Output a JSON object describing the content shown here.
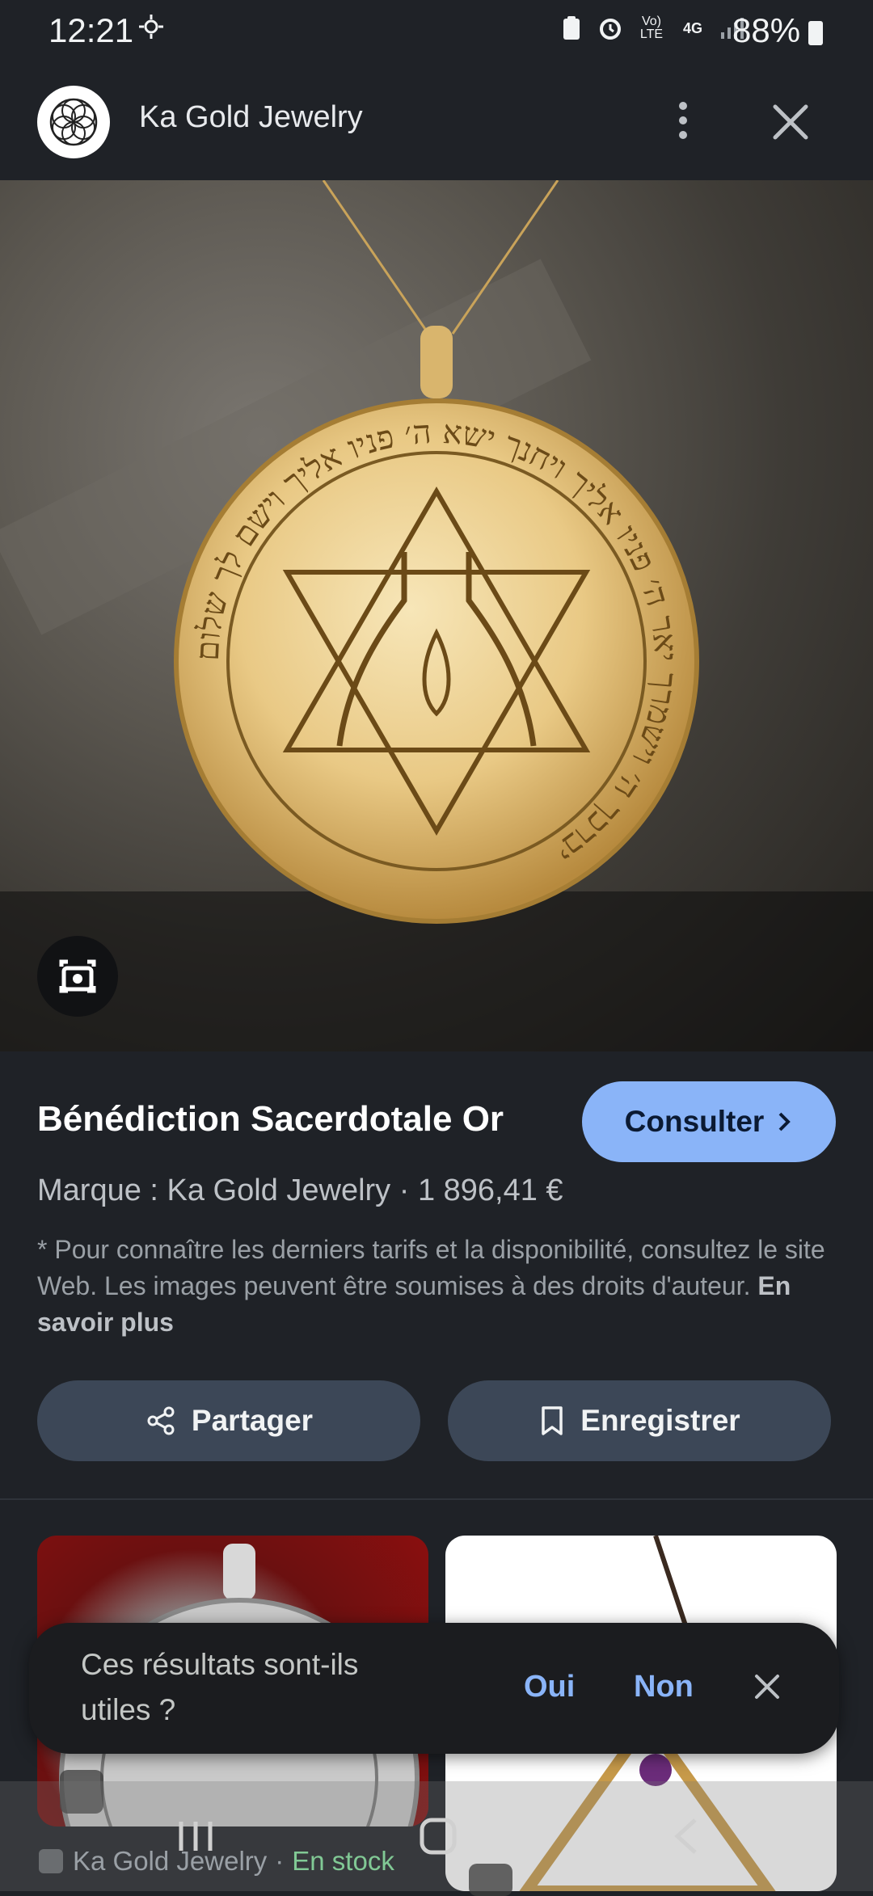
{
  "status_bar": {
    "time": "12:21",
    "battery": "88%",
    "network": "4G",
    "volte": "Vo) LTE"
  },
  "header": {
    "site_name": "Ka Gold Jewelry",
    "menu_icon": "more-vert-icon",
    "close_icon": "close-icon"
  },
  "product": {
    "title": "Bénédiction Sacerdotale Or",
    "visit_label": "Consulter",
    "brand_line": "Marque : Ka Gold Jewelry · 1 896,41 €",
    "disclaimer": "* Pour connaître les derniers tarifs et la disponibilité, consultez le site Web. Les images peuvent être soumises à des droits d'auteur. ",
    "learn_more": "En savoir plus",
    "pendant_text": "יברכך ה׳ וישמרך יאר ה׳ פניו אליך ויחנך ישא ה׳ פניו אליך וישם לך שלום"
  },
  "actions": {
    "share_label": "Partager",
    "save_label": "Enregistrer"
  },
  "results": {
    "source": "Ka Gold Jewelry",
    "separator": " · ",
    "stock": "En stock"
  },
  "feedback": {
    "question": "Ces résultats sont-ils utiles ?",
    "yes": "Oui",
    "no": "Non"
  },
  "colors": {
    "accent": "#8ab4f8",
    "background": "#1f2227",
    "pill": "#3c4757",
    "in_stock": "#81c995"
  }
}
